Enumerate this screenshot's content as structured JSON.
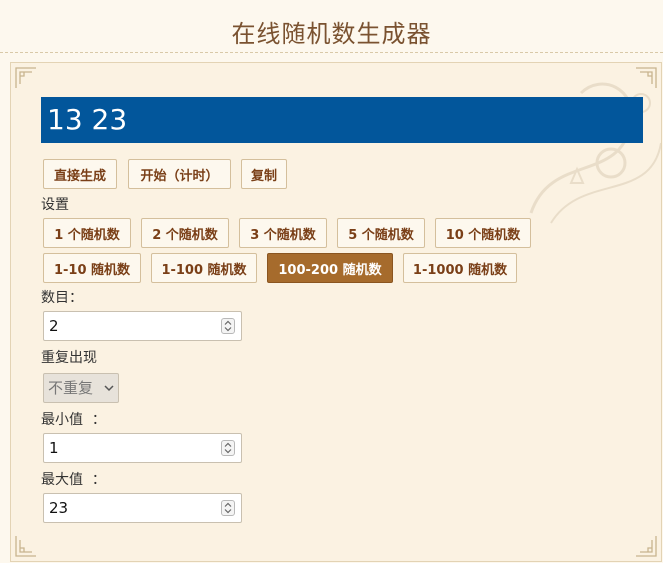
{
  "header": {
    "title": "在线随机数生成器"
  },
  "result": {
    "value": "13 23"
  },
  "actions": {
    "direct_label": "直接生成",
    "start_label": "开始（计时）",
    "copy_label": "复制"
  },
  "settings": {
    "label": "设置",
    "count_presets": [
      "1 个随机数",
      "2 个随机数",
      "3 个随机数",
      "5 个随机数",
      "10 个随机数"
    ],
    "range_presets": [
      "1-10 随机数",
      "1-100 随机数",
      "100-200 随机数",
      "1-1000 随机数"
    ],
    "active_range_preset": "100-200 随机数"
  },
  "fields": {
    "count_label": "数目：",
    "count_value": "2",
    "repeat_label": "重复出现",
    "repeat_value": "不重复",
    "min_label": "最小值  ：",
    "min_value": "1",
    "max_label": "最大值  ：",
    "max_value": "23"
  },
  "colors": {
    "accent": "#02569b",
    "active_button": "#a66b2c",
    "button_text": "#7a3f17",
    "title": "#7a5230"
  },
  "icons": {
    "corner": "ornament-corner-icon",
    "spinner": "spinner-arrows-icon",
    "select": "chevron-down-icon"
  }
}
